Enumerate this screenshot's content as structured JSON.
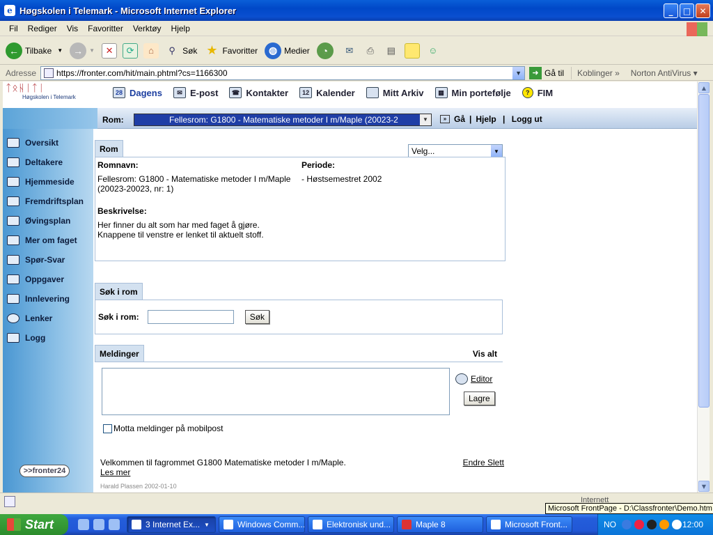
{
  "window": {
    "title": "Høgskolen i Telemark - Microsoft Internet Explorer"
  },
  "menu": [
    "Fil",
    "Rediger",
    "Vis",
    "Favoritter",
    "Verktøy",
    "Hjelp"
  ],
  "toolbar": {
    "back": "Tilbake",
    "search": "Søk",
    "favorites": "Favoritter",
    "media": "Medier"
  },
  "address": {
    "label": "Adresse",
    "url": "https://fronter.com/hit/main.phtml?cs=1166300",
    "go": "Gå til",
    "links": "Koblinger",
    "norton": "Norton AntiVirus"
  },
  "logo": {
    "runes": "ᛏᛟᚺᛁᛏᛁ",
    "name": "Høgskolen i Telemark"
  },
  "topnav": [
    {
      "label": "Dagens",
      "icon": "calendar-day-icon"
    },
    {
      "label": "E-post",
      "icon": "mail-icon"
    },
    {
      "label": "Kontakter",
      "icon": "contacts-icon"
    },
    {
      "label": "Kalender",
      "icon": "calendar-icon"
    },
    {
      "label": "Mitt Arkiv",
      "icon": "folder-icon"
    },
    {
      "label": "Min portefølje",
      "icon": "portfolio-icon"
    },
    {
      "label": "FIM",
      "icon": "help-icon"
    }
  ],
  "roombar": {
    "label": "Rom:",
    "selected": "Fellesrom: G1800 - Matematiske metoder I m/Maple (20023-2",
    "go": "Gå",
    "help": "Hjelp",
    "logout": "Logg ut"
  },
  "sidebar": [
    "Oversikt",
    "Deltakere",
    "Hjemmeside",
    "Fremdriftsplan",
    "Øvingsplan",
    "Mer om faget",
    "Spør-Svar",
    "Oppgaver",
    "Innlevering",
    "Lenker",
    "Logg"
  ],
  "sidebar_logo": ">>fronter24",
  "rom": {
    "tab": "Rom",
    "velg": "Velg...",
    "romnavn_label": "Romnavn:",
    "romnavn": "Fellesrom: G1800 - Matematiske metoder I m/Maple (20023-20023, nr: 1)",
    "periode_label": "Periode:",
    "periode": "- Høstsemestret 2002",
    "beskrivelse_label": "Beskrivelse:",
    "beskrivelse_1": "Her finner du alt som har med faget å gjøre.",
    "beskrivelse_2": "Knappene til venstre er lenket til aktuelt stoff."
  },
  "sok": {
    "tab": "Søk i rom",
    "label": "Søk i rom:",
    "button": "Søk"
  },
  "meldinger": {
    "tab": "Meldinger",
    "vis_alt": "Vis alt",
    "editor": "Editor",
    "lagre": "Lagre",
    "mobil": "Motta meldinger på mobilpost",
    "news_text": "Velkommen til fagrommet G1800 Matematiske metoder I m/Maple.",
    "les_mer": "Les mer",
    "endre": "Endre",
    "slett": "Slett",
    "meta": "Harald Plassen 2002-01-10"
  },
  "status": {
    "zone": "Internett"
  },
  "tooltip": "Microsoft FrontPage - D:\\Classfronter\\Demo.htm",
  "taskbar": {
    "start": "Start",
    "tasks": [
      "3 Internet Ex...",
      "Windows Comm...",
      "Elektronisk und...",
      "Maple 8",
      "Microsoft Front..."
    ],
    "lang": "NO",
    "clock": "12:00"
  }
}
